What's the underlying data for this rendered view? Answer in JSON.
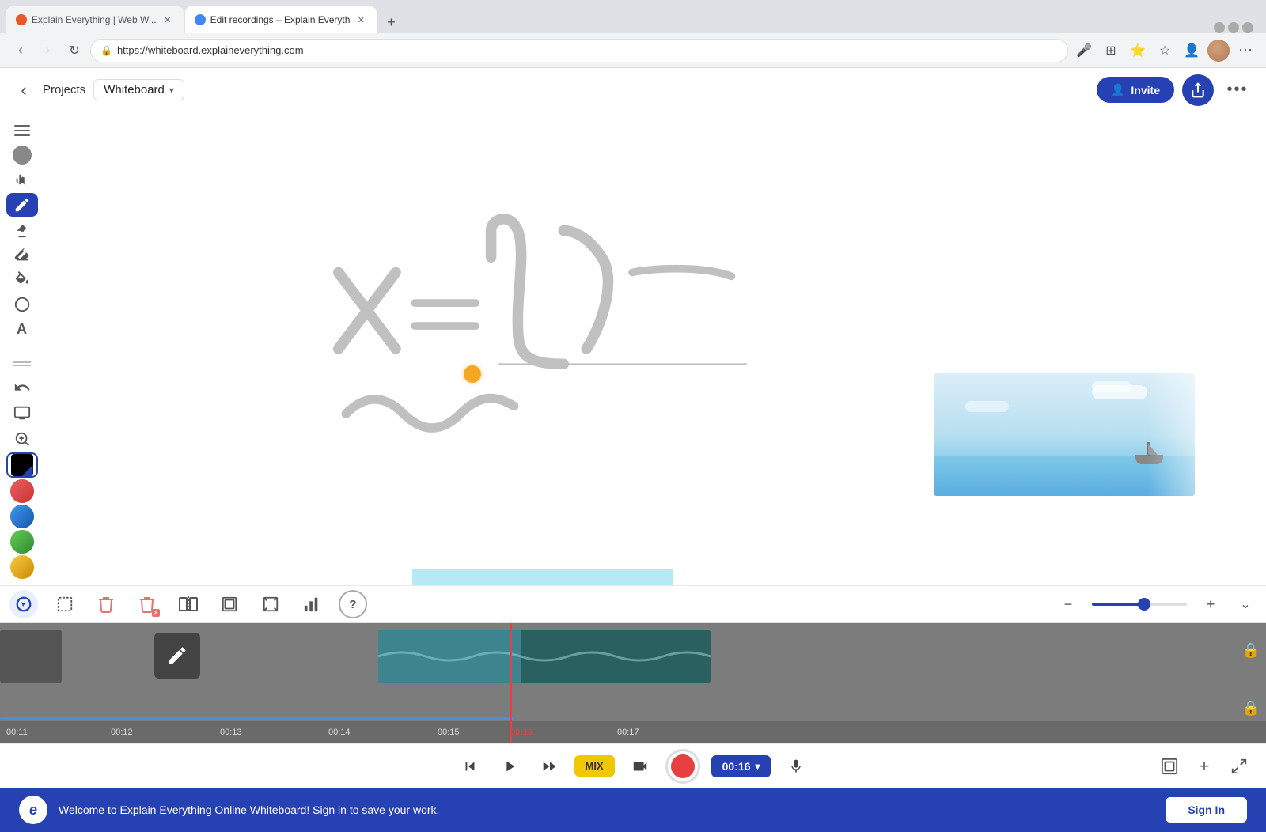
{
  "browser": {
    "tabs": [
      {
        "id": "tab1",
        "favicon_color": "#e8562a",
        "title": "Explain Everything | Web W...",
        "active": false
      },
      {
        "id": "tab2",
        "favicon_color": "#4285f4",
        "title": "Edit recordings – Explain Everyth",
        "active": true
      }
    ],
    "new_tab_label": "+",
    "url": "https://whiteboard.explaineverything.com",
    "nav": {
      "back": "‹",
      "forward": "›",
      "reload": "↻"
    }
  },
  "app_header": {
    "back_icon": "‹",
    "projects_label": "Projects",
    "whiteboard_label": "Whiteboard",
    "dropdown_icon": "▾",
    "invite_label": "Invite",
    "more_icon": "•••"
  },
  "left_toolbar": {
    "tools": [
      {
        "id": "hamburger",
        "icon": "≡",
        "active": false
      },
      {
        "id": "move",
        "icon": "☚",
        "active": false
      },
      {
        "id": "pen",
        "icon": "✏",
        "active": true
      },
      {
        "id": "highlighter",
        "icon": "🖍",
        "active": false
      },
      {
        "id": "eraser",
        "icon": "◻",
        "active": false
      },
      {
        "id": "fill",
        "icon": "◉",
        "active": false
      },
      {
        "id": "shapes",
        "icon": "○",
        "active": false
      },
      {
        "id": "text",
        "icon": "A",
        "active": false
      },
      {
        "id": "undo-redo",
        "icon": "⟲",
        "active": false
      }
    ],
    "colors": [
      {
        "id": "color-gray",
        "value": "#888888"
      },
      {
        "id": "color-black-pen",
        "value": "#222",
        "active": true
      },
      {
        "id": "color-red",
        "value": "#d9534f"
      },
      {
        "id": "color-blue",
        "value": "#2c7bcc"
      },
      {
        "id": "color-green",
        "value": "#4caf50"
      },
      {
        "id": "color-yellow",
        "value": "#f5c518"
      }
    ]
  },
  "timeline_toolbar": {
    "tools": [
      {
        "id": "select-edit",
        "icon": "⊙",
        "active": true
      },
      {
        "id": "select-box",
        "icon": "⬚",
        "active": false
      },
      {
        "id": "delete",
        "icon": "🗑",
        "active": false
      },
      {
        "id": "delete-all",
        "icon": "🗑",
        "active": false
      },
      {
        "id": "split",
        "icon": "⊢⊣",
        "active": false
      },
      {
        "id": "crop",
        "icon": "⬜",
        "active": false
      },
      {
        "id": "mask",
        "icon": "◱",
        "active": false
      },
      {
        "id": "stats",
        "icon": "📊",
        "active": false
      },
      {
        "id": "help",
        "icon": "?",
        "active": false
      }
    ],
    "zoom": {
      "zoom_out_icon": "−",
      "zoom_in_icon": "+",
      "level": 55
    },
    "expand_icon": "⌄"
  },
  "player": {
    "rewind_icon": "⏮",
    "play_icon": "▶",
    "fast_forward_icon": "⏭",
    "mix_label": "MIX",
    "video_icon": "📷",
    "record_color": "#e84040",
    "time_display": "00:16",
    "dropdown_icon": "▾",
    "mic_icon": "🎤"
  },
  "player_right": {
    "scene_icon": "⬚",
    "add_icon": "+",
    "fullscreen_icon": "⤢"
  },
  "timeline": {
    "time_labels": [
      "00:11",
      "00:12",
      "00:13",
      "00:14",
      "00:15",
      "00:16",
      "00:17"
    ],
    "playhead_time": "00:16"
  },
  "banner": {
    "logo": "e",
    "message": "Welcome to Explain Everything Online Whiteboard! Sign in to save your work.",
    "signin_label": "Sign In"
  }
}
